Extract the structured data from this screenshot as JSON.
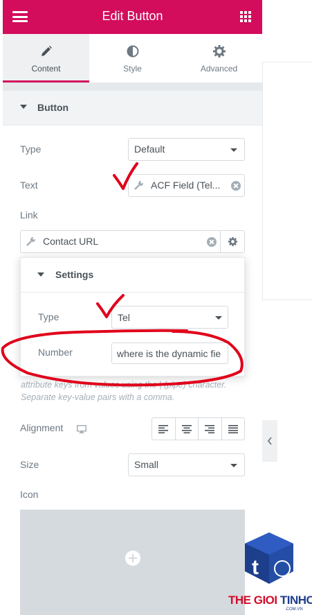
{
  "header": {
    "title": "Edit Button",
    "menu_icon": "hamburger-icon",
    "widgets_icon": "grid-icon"
  },
  "tabs": [
    {
      "label": "Content",
      "icon": "pencil-icon",
      "active": true
    },
    {
      "label": "Style",
      "icon": "half-circle-icon",
      "active": false
    },
    {
      "label": "Advanced",
      "icon": "gear-icon",
      "active": false
    }
  ],
  "section": {
    "title": "Button"
  },
  "controls": {
    "type": {
      "label": "Type",
      "value": "Default"
    },
    "text": {
      "label": "Text",
      "value": "ACF Field (Tel..."
    },
    "link": {
      "label": "Link",
      "value": "Contact URL"
    },
    "alignment": {
      "label": "Alignment"
    },
    "size": {
      "label": "Size",
      "value": "Small"
    },
    "icon": {
      "label": "Icon"
    }
  },
  "popover": {
    "title": "Settings",
    "type": {
      "label": "Type",
      "value": "Tel"
    },
    "number": {
      "label": "Number",
      "value": "where is the dynamic fie"
    }
  },
  "help_text": "attribute keys from values using the | (pipe) character. Separate key-value pairs with a comma.",
  "watermark": {
    "brand_a": "THE GIOI ",
    "brand_b": "TINHOC",
    "sub": ".COM.VN"
  },
  "colors": {
    "accent": "#d30c5c",
    "annotation": "#e0001a"
  }
}
